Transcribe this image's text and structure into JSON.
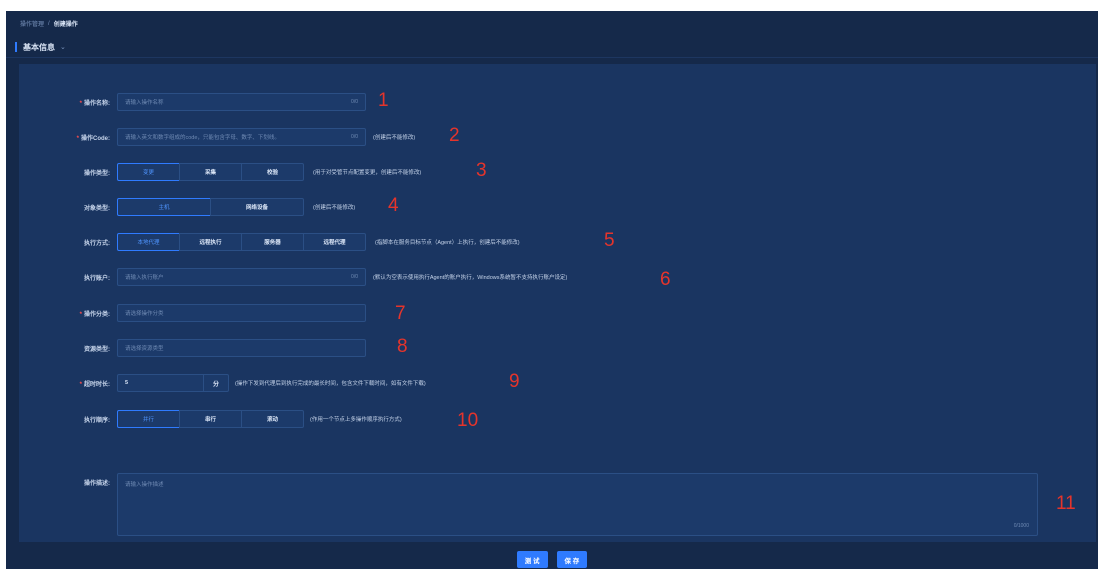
{
  "breadcrumb": {
    "parent": "操作管理",
    "separator": "/",
    "current": "创建操作"
  },
  "section": {
    "title": "基本信息",
    "chevron_icon": "chevron-down-icon"
  },
  "fields": {
    "name": {
      "label": "操作名称:",
      "required": true,
      "placeholder": "请输入操作名称",
      "count": "0/0",
      "annotation": "1"
    },
    "code": {
      "label": "操作Code:",
      "required": true,
      "placeholder": "请输入英文和数字组成的code，只能包含字母、数字、下划线。",
      "count": "0/0",
      "hint": "(创建后不能修改)",
      "annotation": "2"
    },
    "op_type": {
      "label": "操作类型:",
      "options": [
        "变更",
        "采集",
        "校验"
      ],
      "selected": "变更",
      "hint": "(用于对受管节点配置变更，创建后不能修改)",
      "annotation": "3"
    },
    "object_type": {
      "label": "对象类型:",
      "options": [
        "主机",
        "网络设备"
      ],
      "selected": "主机",
      "hint": "(创建后不能修改)",
      "annotation": "4"
    },
    "exec_mode": {
      "label": "执行方式:",
      "options": [
        "本地代理",
        "远程执行",
        "服务器",
        "远程代理"
      ],
      "selected": "本地代理",
      "hint": "(指脚本在服务目标节点（Agent）上执行，创建后不能修改)",
      "annotation": "5"
    },
    "exec_account": {
      "label": "执行账户:",
      "placeholder": "请输入执行账户",
      "count": "0/0",
      "hint": "(默认为空表示使用执行Agent的账户执行，Windows系统暂不支持执行账户设定)",
      "annotation": "6"
    },
    "op_category": {
      "label": "操作分类:",
      "required": true,
      "placeholder": "请选择操作分类",
      "annotation": "7"
    },
    "resource_type": {
      "label": "资源类型:",
      "placeholder": "请选择资源类型",
      "annotation": "8"
    },
    "timeout": {
      "label": "超时时长:",
      "required": true,
      "value": "5",
      "unit": "分",
      "hint": "(操作下发到代理后到执行完成的最长时间，包含文件下载时间，如有文件下载)",
      "annotation": "9"
    },
    "exec_order": {
      "label": "执行顺序:",
      "options": [
        "并行",
        "串行",
        "滚动"
      ],
      "selected": "并行",
      "hint": "(作用一个节点上多操作顺序执行方式)",
      "annotation": "10"
    },
    "description": {
      "label": "操作描述:",
      "placeholder": "请输入操作描述",
      "count": "0/1000",
      "annotation": "11"
    }
  },
  "actions": {
    "test_label": "测 试",
    "save_label": "保 存"
  },
  "colors": {
    "background": "#15294a",
    "panel": "#1a3561",
    "accent": "#2f7bff",
    "annotation": "#e5342b",
    "required": "#ff4d4d"
  }
}
